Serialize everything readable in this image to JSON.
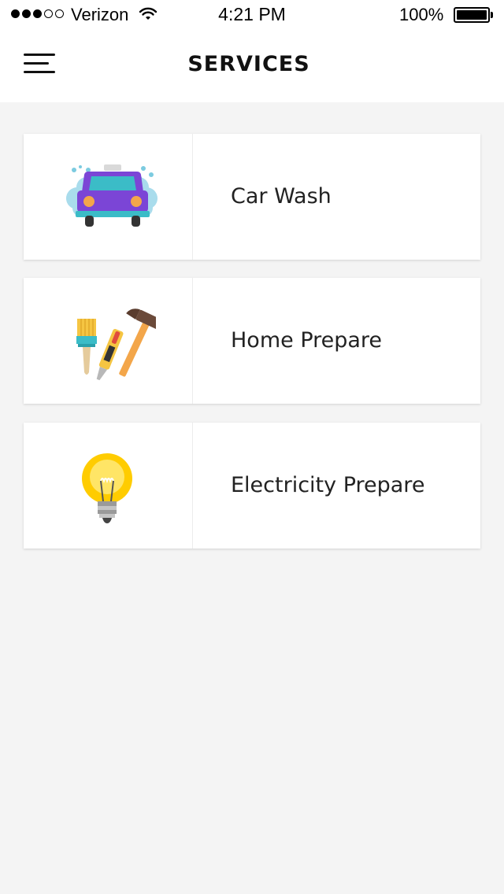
{
  "status_bar": {
    "carrier": "Verizon",
    "time": "4:21 PM",
    "battery": "100%"
  },
  "header": {
    "title": "SERVICES"
  },
  "services": [
    {
      "label": "Car Wash",
      "icon": "car-wash-icon"
    },
    {
      "label": "Home Prepare",
      "icon": "tools-icon"
    },
    {
      "label": "Electricity Prepare",
      "icon": "light-bulb-icon"
    }
  ],
  "colors": {
    "background": "#f4f4f4",
    "card": "#ffffff",
    "text": "#222222",
    "car_body": "#7b45d6",
    "car_window": "#3bbcc7",
    "bulb": "#ffcc00"
  }
}
